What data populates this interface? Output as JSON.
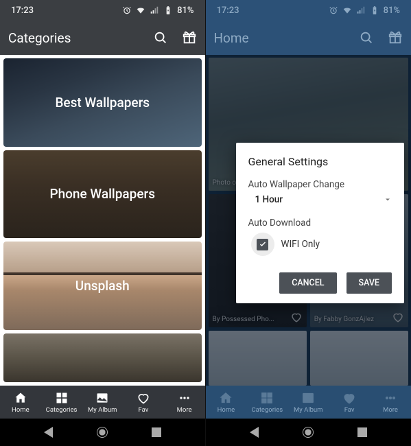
{
  "status": {
    "time": "17:23",
    "battery": "81%"
  },
  "left": {
    "title": "Categories",
    "categories": [
      "Best Wallpapers",
      "Phone Wallpapers",
      "Unsplash"
    ]
  },
  "right": {
    "title": "Home",
    "cards": [
      {
        "caption": "Photo o"
      },
      {
        "caption": "By Possessed Pho..."
      },
      {
        "caption": "By Fabby GonzAjlez"
      }
    ],
    "dialog": {
      "title": "General Settings",
      "auto_change_label": "Auto Wallpaper Change",
      "auto_change_value": "1 Hour",
      "auto_download_label": "Auto Download",
      "wifi_only_label": "WIFI Only",
      "wifi_only_checked": true,
      "cancel": "CANCEL",
      "save": "SAVE"
    }
  },
  "nav": {
    "items": [
      "Home",
      "Categories",
      "My Album",
      "Fav",
      "More"
    ]
  }
}
